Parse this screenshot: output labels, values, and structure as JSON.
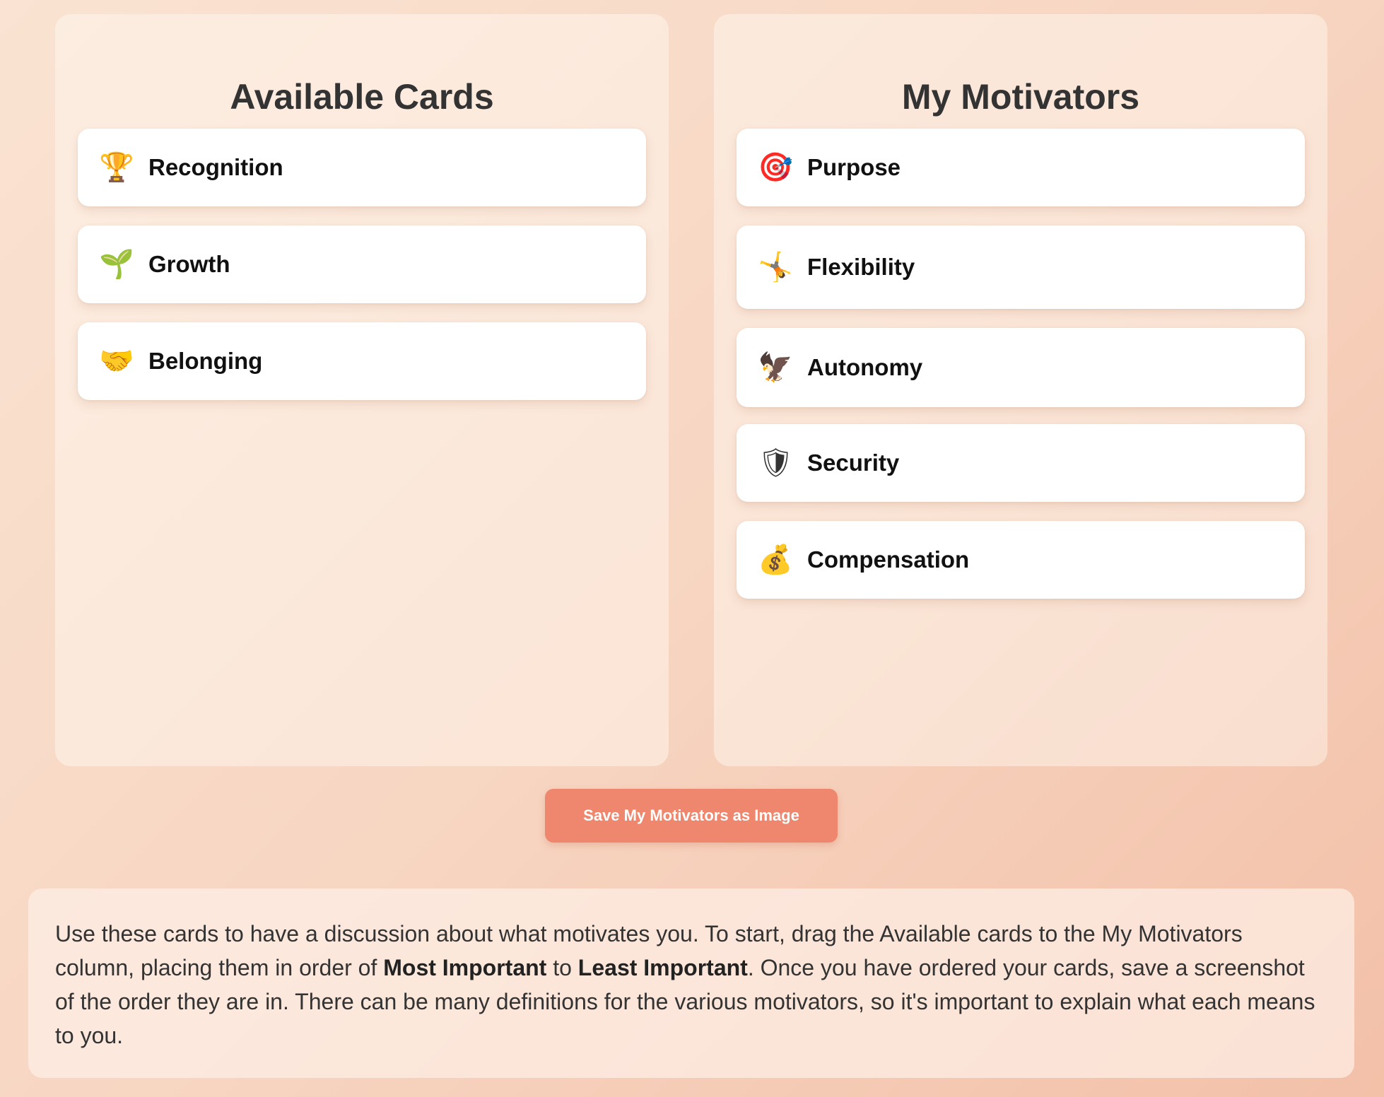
{
  "available": {
    "title": "Available Cards",
    "cards": [
      {
        "icon": "trophy-icon",
        "glyph": "🏆",
        "label": "Recognition"
      },
      {
        "icon": "seedling-icon",
        "glyph": "🌱",
        "label": "Growth"
      },
      {
        "icon": "handshake-icon",
        "glyph": "🤝",
        "label": "Belonging"
      }
    ]
  },
  "motivators": {
    "title": "My Motivators",
    "cards": [
      {
        "icon": "direct-hit-target-icon",
        "glyph": "🎯",
        "label": "Purpose"
      },
      {
        "icon": "cartwheel-person-icon",
        "glyph": "🤸",
        "label": "Flexibility"
      },
      {
        "icon": "eagle-icon",
        "glyph": "🦅",
        "label": "Autonomy"
      },
      {
        "icon": "shield-icon",
        "glyph": "🛡",
        "label": "Security"
      },
      {
        "icon": "money-bag-icon",
        "glyph": "💰",
        "label": "Compensation"
      }
    ]
  },
  "actions": {
    "save_label": "Save My Motivators as Image"
  },
  "instructions": {
    "part1": "Use these cards to have a discussion about what motivates you. To start, drag the Available cards to the My Motivators column, placing them in order of ",
    "bold1": "Most Important",
    "part2": " to ",
    "bold2": "Least Important",
    "part3": ". Once you have ordered your cards, save a screenshot of the order they are in. There can be many definitions for the various motivators, so it's important to explain what each means to you."
  },
  "colors": {
    "button": "#ee876d",
    "card_bg": "#ffffff",
    "heading": "#333333"
  }
}
